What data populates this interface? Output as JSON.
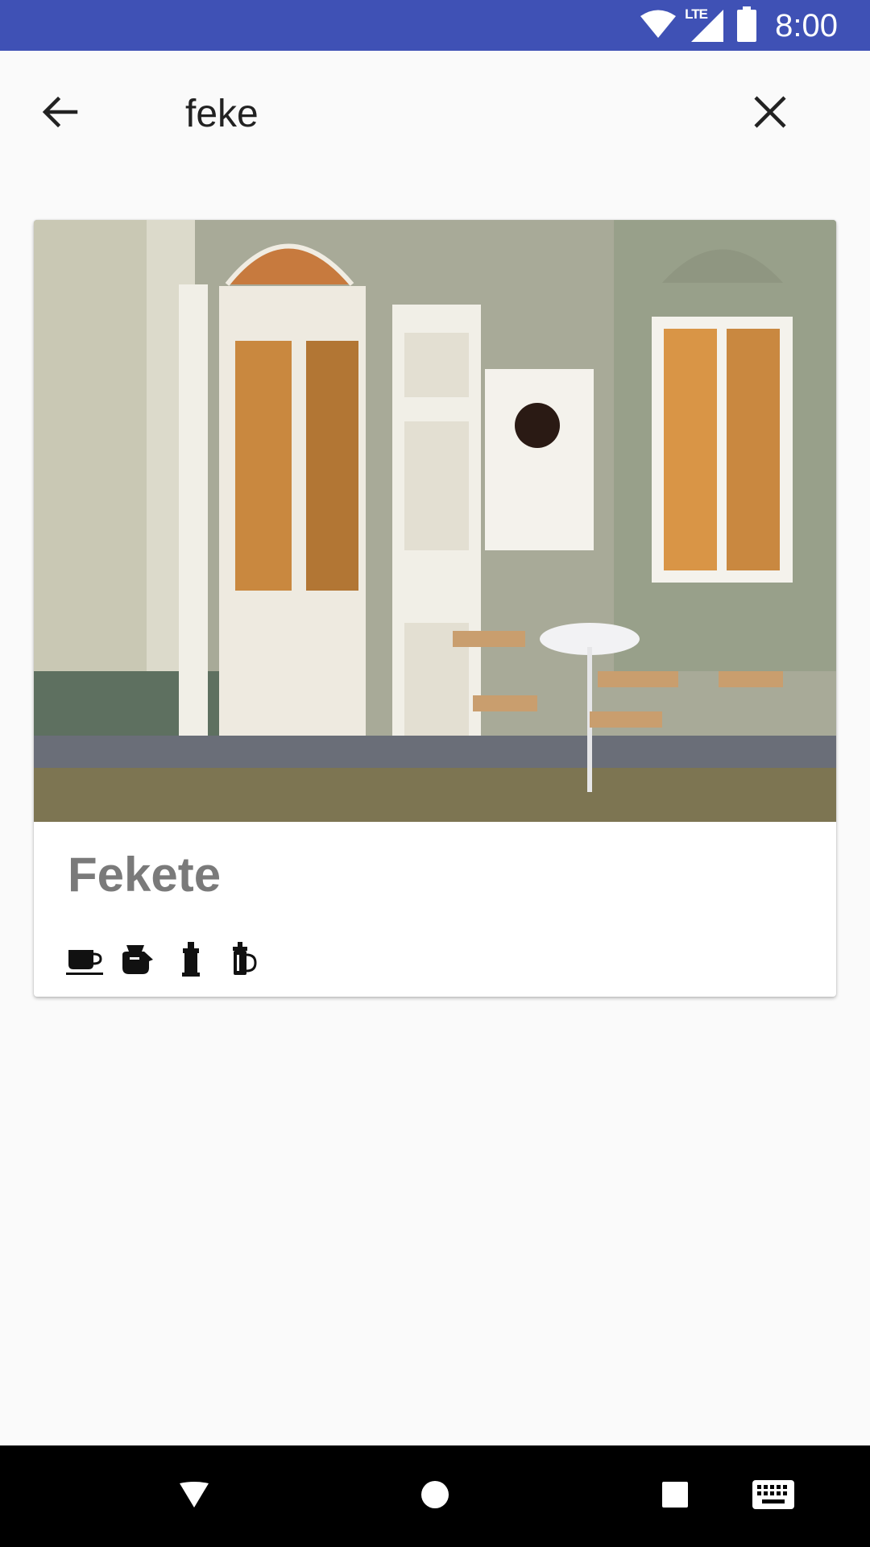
{
  "status_bar": {
    "time": "8:00",
    "network": "LTE",
    "icons": [
      "wifi-icon",
      "lte-signal-icon",
      "battery-icon"
    ]
  },
  "search": {
    "query": "feke",
    "back_icon": "arrow-back-icon",
    "clear_icon": "close-icon"
  },
  "results": [
    {
      "name": "Fekete",
      "brew_methods": [
        "espresso-cup-icon",
        "filter-kettle-icon",
        "aeropress-icon",
        "french-press-icon"
      ]
    }
  ],
  "nav_bar": {
    "icons": [
      "back-triangle-icon",
      "home-circle-icon",
      "recents-square-icon",
      "keyboard-icon"
    ]
  },
  "colors": {
    "status_bar": "#3f51b5",
    "background": "#fafafa",
    "title": "#7a7a7a",
    "nav_bar": "#000000"
  }
}
